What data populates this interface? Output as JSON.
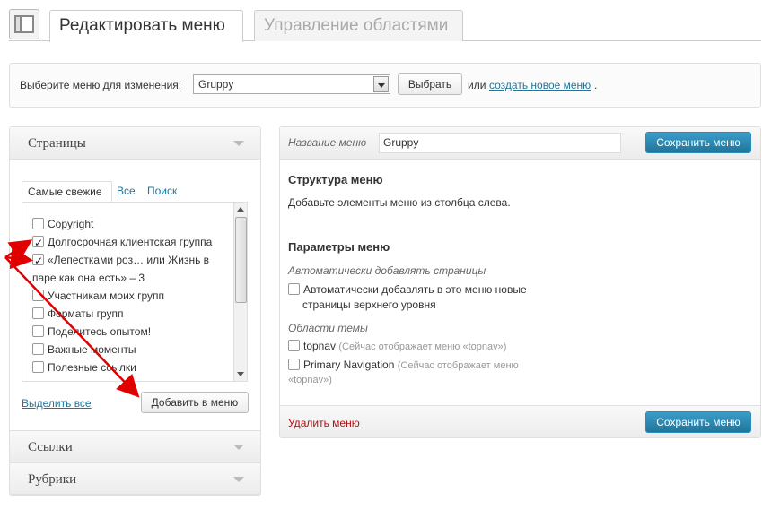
{
  "tabs": {
    "active": "Редактировать меню",
    "inactive": "Управление областями"
  },
  "selector": {
    "label": "Выберите меню для изменения:",
    "selected": "Gruppy",
    "button": "Выбрать",
    "or": "или",
    "create_link": "создать новое меню",
    "dot": "."
  },
  "left": {
    "pages_title": "Страницы",
    "subtabs": [
      "Самые свежие",
      "Все",
      "Поиск"
    ],
    "items": [
      {
        "label": "Copyright",
        "checked": false
      },
      {
        "label": "Долгосрочная клиентская группа",
        "checked": true
      },
      {
        "label": "«Лепестками роз… или Жизнь в",
        "checked": true
      },
      {
        "label": "паре как она есть» – 3",
        "checked": false
      },
      {
        "label": "Участникам моих групп",
        "checked": false
      },
      {
        "label": "Форматы групп",
        "checked": false
      },
      {
        "label": "Поделитесь опытом!",
        "checked": false
      },
      {
        "label": "Важные моменты",
        "checked": false
      },
      {
        "label": "Полезные ссылки",
        "checked": false
      }
    ],
    "select_all": "Выделить все",
    "add_button": "Добавить в меню",
    "links_title": "Ссылки",
    "rubrics_title": "Рубрики"
  },
  "right": {
    "name_label": "Название меню",
    "name_value": "Gruppy",
    "save": "Сохранить меню",
    "structure_title": "Структура меню",
    "structure_hint": "Добавьте элементы меню из столбца слева.",
    "params_title": "Параметры меню",
    "auto_label": "Автоматически добавлять страницы",
    "auto_check_line1": "Автоматически добавлять в это меню новые",
    "auto_check_line2": "страницы верхнего уровня",
    "areas_label": "Области темы",
    "area1_name": "topnav",
    "area1_note": "(Сейчас отображает меню «topnav»)",
    "area2_name": "Primary Navigation",
    "area2_note_line1": "(Сейчас отображает меню",
    "area2_note_line2": "«topnav»)",
    "delete": "Удалить меню"
  },
  "colors": {
    "accent": "#21759b",
    "delete": "#bc0b0b",
    "annotation_arrow": "#e00000"
  }
}
